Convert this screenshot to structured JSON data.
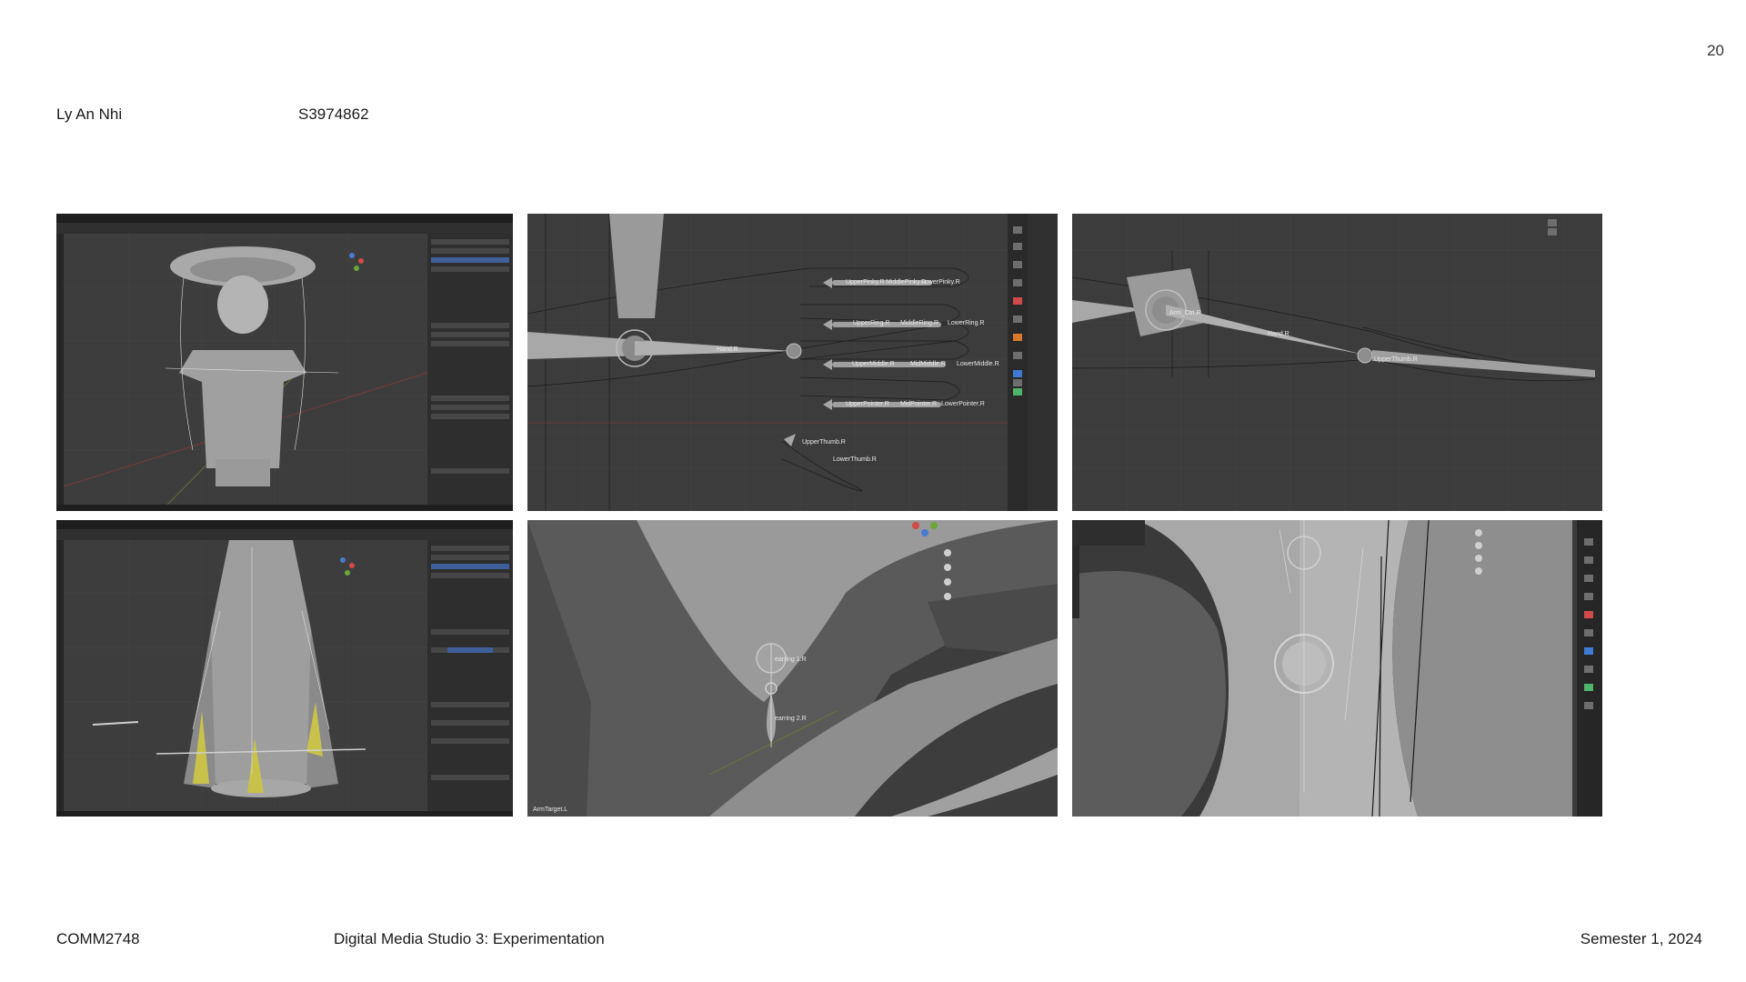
{
  "header": {
    "page_number": "20",
    "author": "Ly An Nhi",
    "student_id": "S3974862"
  },
  "footer": {
    "course_code": "COMM2748",
    "course_title": "Digital Media Studio 3: Experimentation",
    "semester": "Semester 1, 2024"
  },
  "screenshots": {
    "hand_front": {
      "bones": {
        "upper_pinky": "UpperPinky.R",
        "middle_pinky": "MiddlePinky.R",
        "lower_pinky": "LowerPinky.R",
        "upper_ring": "UpperRing.R",
        "middle_ring": "MiddleRing.R",
        "lower_ring": "LowerRing.R",
        "upper_middle": "UpperMiddle.R",
        "middle_middle": "MidMiddle.R",
        "lower_middle": "LowerMiddle.R",
        "upper_pointer": "UpperPointer.R",
        "middle_pointer": "MidPointer.R",
        "lower_pointer": "LowerPointer.R",
        "upper_thumb": "UpperThumb.R",
        "lower_thumb": "LowerThumb.R",
        "hand": "Hand.R"
      }
    },
    "hand_side": {
      "bones": {
        "arm_ctrl": "Arm_Ctrl.R",
        "hand": "Hand.R",
        "upper_thumb": "UpperThumb.R"
      }
    },
    "earring": {
      "bones": {
        "earring_1": "earring 1.R",
        "earring_2": "earring 2.R",
        "arm_target": "ArmTarget.L"
      }
    }
  }
}
